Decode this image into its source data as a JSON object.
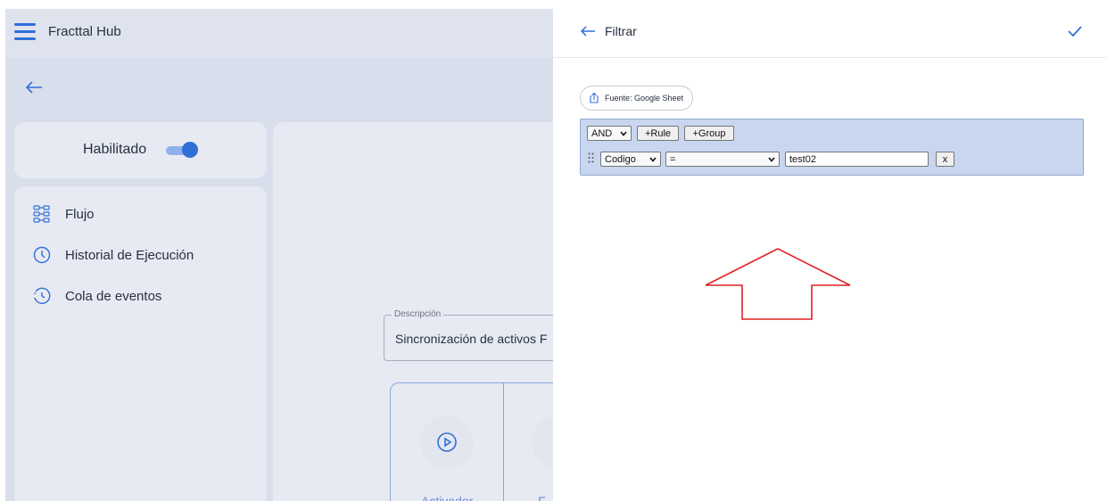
{
  "app": {
    "title": "Fracttal Hub",
    "enabled_label": "Habilitado",
    "nav_items": [
      {
        "label": "Flujo",
        "icon": "flow-icon"
      },
      {
        "label": "Historial de Ejecución",
        "icon": "clock-icon"
      },
      {
        "label": "Cola de eventos",
        "icon": "history-icon"
      }
    ],
    "description": {
      "legend": "Descripción",
      "value": "Sincronización de activos F"
    },
    "flow_steps": [
      {
        "label": "Activador",
        "icon": "play-icon"
      },
      {
        "label": "F"
      }
    ],
    "accent_color": "#2f6fd6"
  },
  "filter_panel": {
    "title": "Filtrar",
    "source_label": "Fuente: Google Sheet",
    "query": {
      "combinator": "AND",
      "add_rule_label": "+Rule",
      "add_group_label": "+Group",
      "rule": {
        "field": "Codigo",
        "operator": "=",
        "value": "test02",
        "remove_label": "x"
      }
    },
    "group_color": "#c8d6ef"
  },
  "annotation": {
    "arrow_color": "#e02020"
  }
}
